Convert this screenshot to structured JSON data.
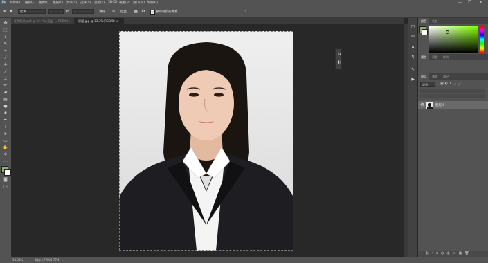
{
  "menu": {
    "items": [
      "文件(F)",
      "编辑(E)",
      "图像(I)",
      "图层(L)",
      "文字(Y)",
      "选择(S)",
      "滤镜(T)",
      "3D(D)",
      "视图(V)",
      "窗口(W)",
      "帮助(H)"
    ],
    "minimize": "—",
    "restore": "❐",
    "close": "✕"
  },
  "options": {
    "ratio": "比例",
    "clear": "清除",
    "straighten_icon": "straighten-icon",
    "delete_cropped_label": "删除裁剪的像素",
    "delete_cropped_checked": true,
    "reset_icon": "reset-icon"
  },
  "tabs": [
    {
      "label": "证件照片.psd @ 66.7% (图层 1, RGB/8) ×",
      "active": false
    },
    {
      "label": "原图.jpg @ 33.3%(RGB/8) ×",
      "active": true
    }
  ],
  "tools": [
    "move-icon",
    "marquee-icon",
    "lasso-icon",
    "quick-select-icon",
    "crop-icon",
    "eyedropper-icon",
    "healing-icon",
    "brush-icon",
    "clone-stamp-icon",
    "history-brush-icon",
    "eraser-icon",
    "gradient-icon",
    "blur-icon",
    "dodge-icon",
    "pen-icon",
    "type-icon",
    "path-select-icon",
    "shape-icon",
    "hand-icon",
    "zoom-icon",
    "more-icon"
  ],
  "colors": {
    "foreground": "#8db06a",
    "background": "#ffffff",
    "hue_top": "#62c91a",
    "picker_base": "#80ff00",
    "canvas_bg": "#282828",
    "panel_bg": "#535353",
    "guide": "#22c6e0"
  },
  "panels": {
    "color_tabs": [
      "颜色",
      "色板"
    ],
    "adjust_tabs": [
      "属性",
      "调整",
      "样式"
    ],
    "layers_tabs": [
      "图层",
      "通道",
      "路径"
    ],
    "kind_label": "类型",
    "layer": {
      "name": "图层 0",
      "visible": true
    }
  },
  "status": {
    "zoom": "33.33%",
    "doc_info": "文档:6.77M/6.77M"
  }
}
